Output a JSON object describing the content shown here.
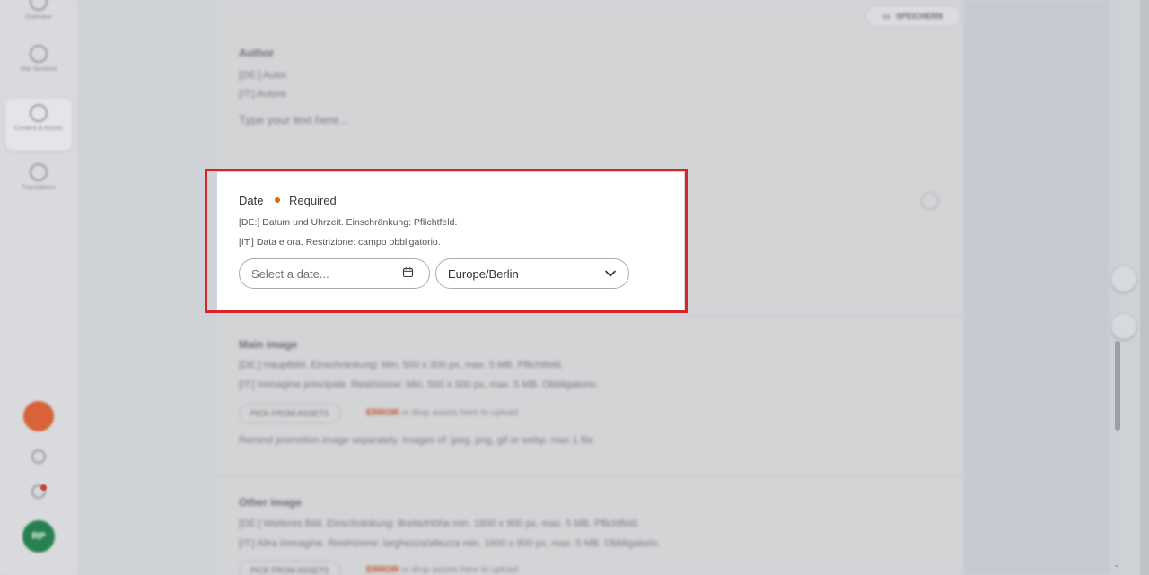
{
  "sidebar": {
    "items": [
      {
        "label": "Overview"
      },
      {
        "label": "Site Sections"
      },
      {
        "label": "Content & Assets"
      },
      {
        "label": "Translations"
      }
    ],
    "avatar_initials": "RP"
  },
  "toolbar": {
    "save_label": "SPEICHERN"
  },
  "blurred_sections": {
    "author": {
      "title": "Author",
      "lines": [
        "[DE:] Autor.",
        "[IT:] Autore."
      ],
      "placeholder": "Type your text here..."
    },
    "main_image": {
      "title": "Main image",
      "lines": [
        "[DE:] Hauptbild. Einschränkung: Min. 500 x 300 px, max. 5 MB. Pflichtfeld.",
        "[IT:] Immagine principale. Restrizione: Min. 500 x 300 px, max. 5 MB. Obbligatorio."
      ],
      "field_label": "PICK FROM ASSETS",
      "warning_label": "ERROR",
      "warning_text": "or drop assets here to upload",
      "note": "Remind promotion image separately. Images of: jpeg, png, gif or webp. max 1 file."
    },
    "other_image": {
      "title": "Other image",
      "lines": [
        "[DE:] Weiteres Bild. Einschränkung: Breite/Höhe min. 1600 x 900 px, max. 5 MB. Pflichtfeld.",
        "[IT:] Altra immagine. Restrizione: larghezza/altezza min. 1600 x 900 px, max. 5 MB. Obbligatorio."
      ],
      "field_label": "PICK FROM ASSETS",
      "warning_label": "ERROR",
      "warning_text": "or drop assets here to upload"
    }
  },
  "date_field": {
    "title": "Date",
    "required_label": "Required",
    "help_de": "[DE:] Datum und Uhrzeit. Einschränkung: Pflichtfeld.",
    "help_it": "[IT:] Data e ora. Restrizione: campo obbligatorio.",
    "date_placeholder": "Select a date...",
    "timezone_value": "Europe/Berlin"
  },
  "colors": {
    "highlight_frame": "#d6242d",
    "required_dot": "#d66a17",
    "fab": "#d8623a",
    "avatar": "#27804f"
  },
  "icons": [
    "calendar-icon",
    "chevron-down-icon",
    "add-icon",
    "globe-icon",
    "settings-icon",
    "notification-icon"
  ]
}
